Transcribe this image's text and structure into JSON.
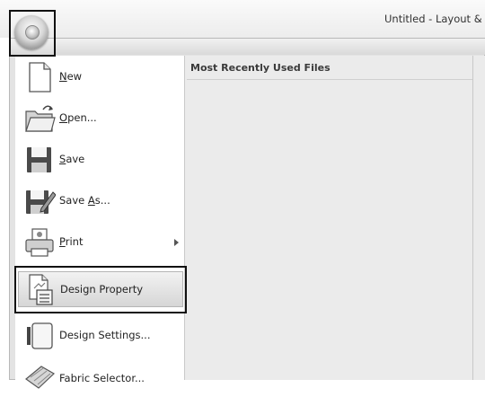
{
  "window": {
    "title": "Untitled - Layout &"
  },
  "app_menu": {
    "items": [
      {
        "label_underlined": "N",
        "label_rest": "ew",
        "icon": "new-document-icon"
      },
      {
        "label_underlined": "O",
        "label_rest": "pen...",
        "icon": "open-folder-icon"
      },
      {
        "label_underlined": "S",
        "label_rest": "ave",
        "icon": "save-disk-icon"
      },
      {
        "label_prefix": "Save ",
        "label_underlined": "A",
        "label_rest": "s...",
        "icon": "save-as-icon"
      },
      {
        "label_underlined": "P",
        "label_rest": "rint",
        "icon": "printer-icon"
      },
      {
        "label": "Design Property",
        "icon": "design-property-icon"
      },
      {
        "label": "Design Settings...",
        "icon": "design-settings-icon"
      },
      {
        "label": "Fabric Selector...",
        "icon": "fabric-selector-icon"
      }
    ],
    "mru_title": "Most Recently Used Files"
  }
}
